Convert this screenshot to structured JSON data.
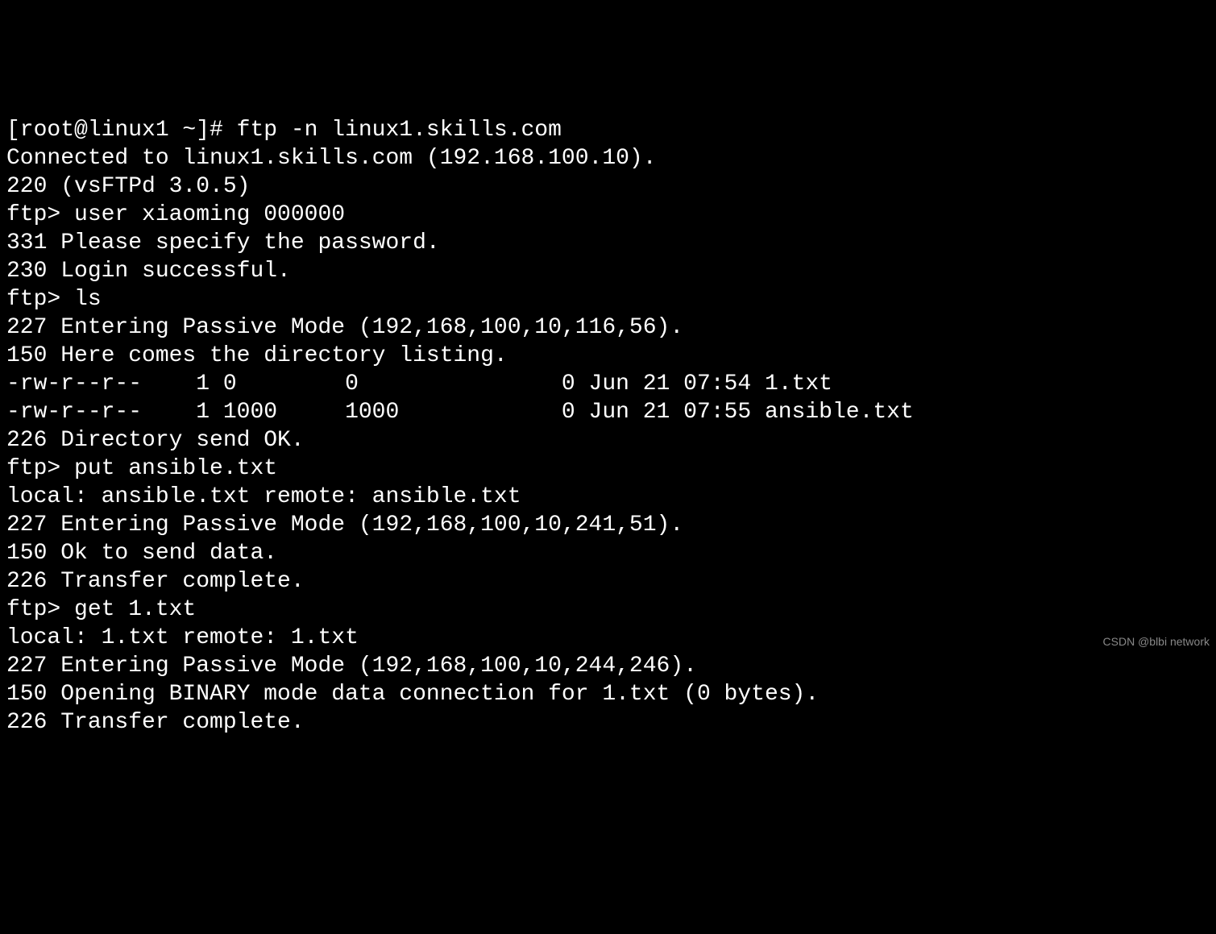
{
  "lines": {
    "l0": "[root@linux1 ~]# ftp -n linux1.skills.com",
    "l1": "Connected to linux1.skills.com (192.168.100.10).",
    "l2": "220 (vsFTPd 3.0.5)",
    "l3": "ftp> user xiaoming 000000",
    "l4": "331 Please specify the password.",
    "l5": "230 Login successful.",
    "l6": "ftp> ls",
    "l7": "227 Entering Passive Mode (192,168,100,10,116,56).",
    "l8": "150 Here comes the directory listing.",
    "l9": "-rw-r--r--    1 0        0               0 Jun 21 07:54 1.txt",
    "l10": "-rw-r--r--    1 1000     1000            0 Jun 21 07:55 ansible.txt",
    "l11": "226 Directory send OK.",
    "l12": "ftp> put ansible.txt",
    "l13": "local: ansible.txt remote: ansible.txt",
    "l14": "227 Entering Passive Mode (192,168,100,10,241,51).",
    "l15": "150 Ok to send data.",
    "l16": "226 Transfer complete.",
    "l17": "ftp> get 1.txt",
    "l18": "local: 1.txt remote: 1.txt",
    "l19": "227 Entering Passive Mode (192,168,100,10,244,246).",
    "l20": "150 Opening BINARY mode data connection for 1.txt (0 bytes).",
    "l21": "226 Transfer complete."
  },
  "watermark": "CSDN @blbi network"
}
